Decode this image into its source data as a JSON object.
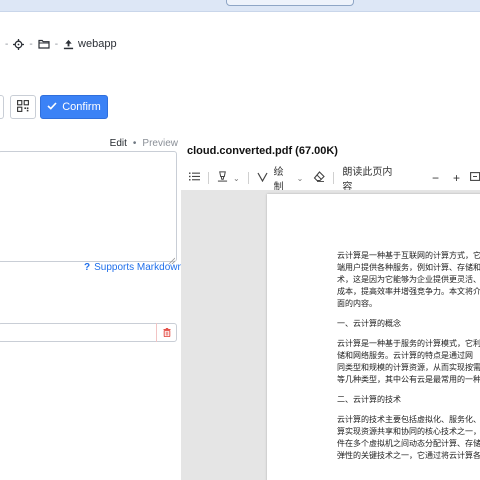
{
  "breadcrumb": {
    "items": [
      {
        "icon": "crosshair-icon",
        "label": ""
      },
      {
        "icon": "folder-icon",
        "label": ""
      },
      {
        "icon": "upload-icon",
        "label": "webapp"
      }
    ],
    "separator": "-"
  },
  "actions": {
    "confirm_label": "Confirm"
  },
  "editor": {
    "tab_edit": "Edit",
    "tab_separator": "•",
    "tab_preview": "Preview",
    "markdown_hint": "Supports Markdown",
    "markdown_hint_icon": "?"
  },
  "viewer": {
    "title": "cloud.converted.pdf (67.00K)",
    "toolbar": {
      "draw_label": "绘制",
      "read_aloud_label": "朗读此页内容",
      "zoom_out": "−",
      "zoom_in": "+"
    },
    "page_lines": [
      "云计算是一种基于互联网的计算方式，它",
      "端用户提供各种服务，例如计算、存储和",
      "术，这是因为它能够为企业提供更灵活、",
      "成本，提高效率并增强竞争力。本文将介",
      "面的内容。",
      "",
      "一、云计算的概念",
      "",
      "云计算是一种基于服务的计算模式，它利",
      "储和网络服务。云计算的特点是通过网",
      "同类型和规模的计算资源，从而实现按需",
      "等几种类型，其中公有云是最常用的一种",
      "",
      "二、云计算的技术",
      "",
      "云计算的技术主要包括虚拟化、服务化、",
      "算实现资源共享和协同的核心技术之一，",
      "件在多个虚拟机之间动态分配计算、存储",
      "弹性的关键技术之一，它通过将云计算各"
    ]
  },
  "colors": {
    "accent": "#3b82f6",
    "link": "#1f6feb",
    "danger": "#e5534b",
    "viewer_bg": "#e5e5e5"
  }
}
